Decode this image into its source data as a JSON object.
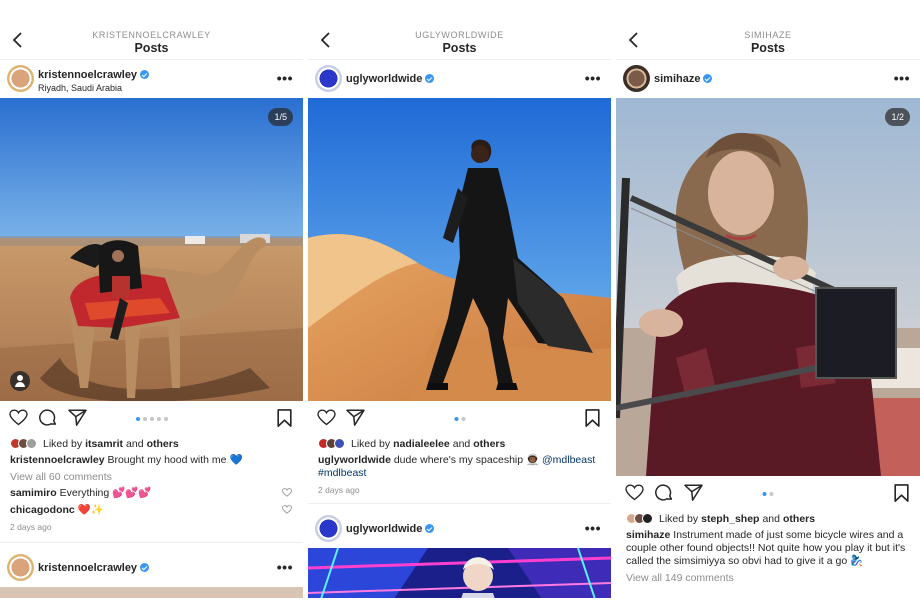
{
  "panel1": {
    "header_username": "KRISTENNOELCRAWLEY",
    "header_title": "Posts",
    "post": {
      "username": "kristennoelcrawley",
      "location": "Riyadh, Saudi Arabia",
      "counter": "1/5",
      "liked_prefix": "Liked by",
      "liked_user": "itsamrit",
      "liked_and": "and",
      "liked_others": "others",
      "caption_user": "kristennoelcrawley",
      "caption_text": " Brought my hood with me 💙",
      "view_comments": "View all 60 comments",
      "comments": [
        {
          "user": "samimiro",
          "text": " Everything 💕💕💕"
        },
        {
          "user": "chicagodonc",
          "text": " ❤️✨"
        }
      ],
      "time": "2 days ago"
    },
    "next_post_username": "kristennoelcrawley"
  },
  "panel2": {
    "header_username": "UGLYWORLDWIDE",
    "header_title": "Posts",
    "post": {
      "username": "uglyworldwide",
      "liked_prefix": "Liked by",
      "liked_user": "nadialeelee",
      "liked_and": "and",
      "liked_others": "others",
      "caption_user": "uglyworldwide",
      "caption_text": " dude where's my spaceship 👨🏾‍🚀 ",
      "caption_mention": "@mdlbeast",
      "caption_hashtag": "#mdlbeast",
      "time": "2 days ago"
    },
    "next_post_username": "uglyworldwide"
  },
  "panel3": {
    "header_username": "SIMIHAZE",
    "header_title": "Posts",
    "post": {
      "username": "simihaze",
      "counter": "1/2",
      "liked_prefix": "Liked by",
      "liked_user": "steph_shep",
      "liked_and": "and",
      "liked_others": "others",
      "caption_user": "simihaze",
      "caption_text": " Instrument made of just some bicycle wires and a couple other found objects!! Not quite how you play it but it's called the simsimiyya so obvi had to give it a go 🧞‍♀️",
      "view_comments": "View all 149 comments"
    }
  },
  "colors": {
    "text": "#262626",
    "muted": "#8e8e8e",
    "accent": "#3897f0",
    "link": "#003569"
  },
  "icons": [
    "back-chevron-icon",
    "verified-badge-icon",
    "more-options-icon",
    "heart-icon",
    "comment-icon",
    "share-icon",
    "bookmark-icon",
    "user-tag-icon"
  ]
}
